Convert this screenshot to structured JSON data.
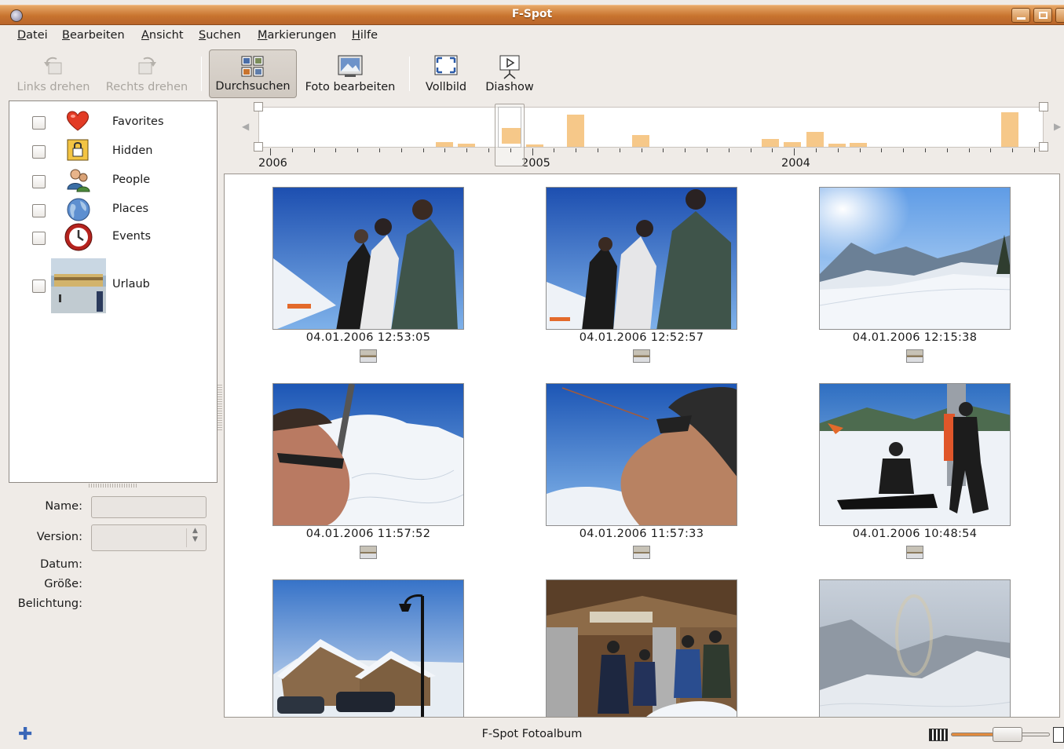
{
  "window": {
    "title": "F-Spot"
  },
  "menubar": {
    "items": [
      {
        "mnemonic": "D",
        "rest": "atei"
      },
      {
        "mnemonic": "B",
        "rest": "earbeiten"
      },
      {
        "mnemonic": "A",
        "rest": "nsicht"
      },
      {
        "mnemonic": "S",
        "rest": "uchen"
      },
      {
        "mnemonic": "M",
        "rest": "arkierungen"
      },
      {
        "mnemonic": "H",
        "rest": "ilfe"
      }
    ]
  },
  "toolbar": {
    "rotate_left": "Links drehen",
    "rotate_right": "Rechts drehen",
    "browse": "Durchsuchen",
    "edit_photo": "Foto bearbeiten",
    "fullscreen": "Vollbild",
    "slideshow": "Diashow"
  },
  "tags": [
    {
      "name": "Favorites",
      "icon": "heart-icon",
      "checked": false
    },
    {
      "name": "Hidden",
      "icon": "lock-icon",
      "checked": false
    },
    {
      "name": "People",
      "icon": "people-icon",
      "checked": false
    },
    {
      "name": "Places",
      "icon": "globe-icon",
      "checked": false
    },
    {
      "name": "Events",
      "icon": "clock-icon",
      "checked": false
    },
    {
      "name": "Urlaub",
      "icon": "photo-thumbnail",
      "checked": false
    }
  ],
  "info": {
    "name_label": "Name:",
    "name_value": "",
    "version_label": "Version:",
    "version_value": "",
    "date_label": "Datum:",
    "size_label": "Größe:",
    "exposure_label": "Belichtung:"
  },
  "timeline": {
    "years": [
      "2006",
      "2005",
      "2004"
    ],
    "bars": [
      0.12,
      0.09,
      0.28,
      0.06,
      0.9,
      0.32,
      0.22,
      0.12,
      0.42,
      0.08,
      0.1,
      0.95
    ]
  },
  "photos": [
    {
      "caption": "04.01.2006 12:53:05",
      "scene": "skiers-sky"
    },
    {
      "caption": "04.01.2006 12:52:57",
      "scene": "skiers-sky"
    },
    {
      "caption": "04.01.2006 12:15:38",
      "scene": "mountain-valley"
    },
    {
      "caption": "04.01.2006 11:57:52",
      "scene": "face-snow"
    },
    {
      "caption": "04.01.2006 11:57:33",
      "scene": "face-sky"
    },
    {
      "caption": "04.01.2006 10:48:54",
      "scene": "snowboarder"
    },
    {
      "caption": "",
      "scene": "chalet-lamp"
    },
    {
      "caption": "",
      "scene": "group-hut"
    },
    {
      "caption": "",
      "scene": "fog-snow"
    }
  ],
  "statusbar": {
    "text": "F-Spot Fotoalbum"
  },
  "colors": {
    "titlebar": "#c8742f",
    "timeline_bar": "#f6c889",
    "zoom_fill": "#e38b3d"
  }
}
